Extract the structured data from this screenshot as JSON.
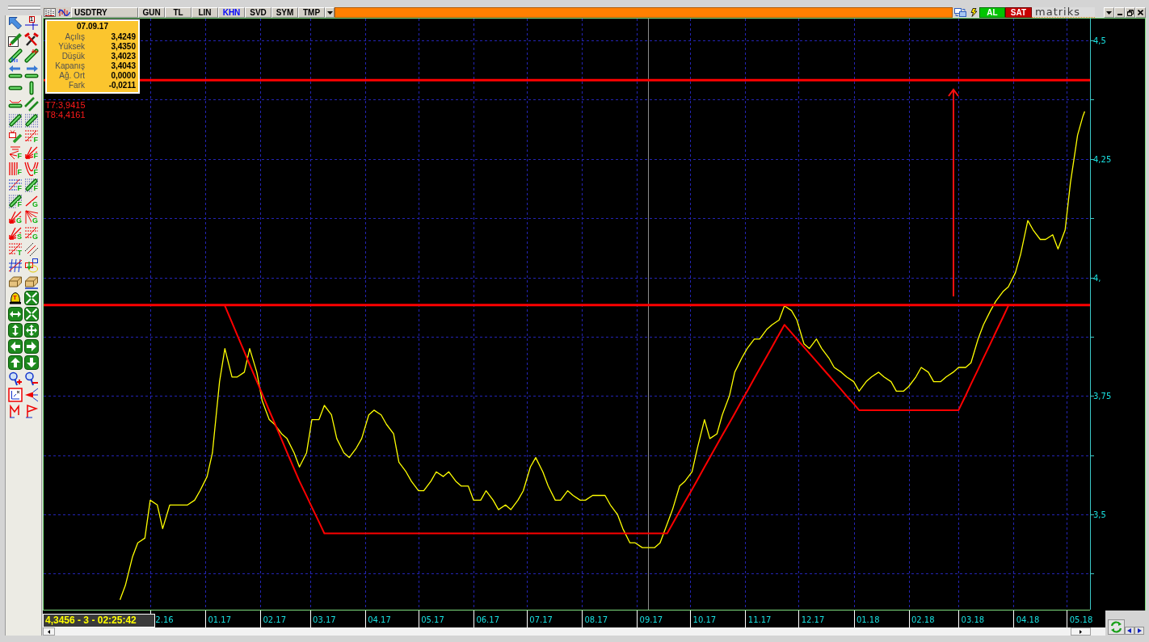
{
  "toolbar": {
    "symbol": "USDTRY",
    "buttons": [
      {
        "label": "GUN",
        "on": false
      },
      {
        "label": "TL",
        "on": false
      },
      {
        "label": "LIN",
        "on": false
      },
      {
        "label": "KHN",
        "on": true
      },
      {
        "label": "SVD",
        "on": false
      },
      {
        "label": "SYM",
        "on": false
      },
      {
        "label": "TMP",
        "on": false
      }
    ],
    "buy": "AL",
    "sell": "SAT",
    "logo": "matriks"
  },
  "drawing_tools": [
    {
      "kind": "pointer"
    },
    {
      "kind": "crosshair",
      "badge": "1"
    },
    {
      "kind": "pencil"
    },
    {
      "kind": "hammers"
    },
    {
      "kind": "trend"
    },
    {
      "kind": "trendmark"
    },
    {
      "kind": "extendleft"
    },
    {
      "kind": "extendright"
    },
    {
      "kind": "horizontal"
    },
    {
      "kind": "vertical"
    },
    {
      "kind": "ruler"
    },
    {
      "kind": "parallel"
    },
    {
      "kind": "dotted"
    },
    {
      "kind": "dotted"
    },
    {
      "kind": "note"
    },
    {
      "kind": "fibo",
      "badge": "F"
    },
    {
      "kind": "fibofan",
      "badge": "F"
    },
    {
      "kind": "fan",
      "badge": "F"
    },
    {
      "kind": "cycles",
      "badge": "F"
    },
    {
      "kind": "arcs",
      "badge": "F"
    },
    {
      "kind": "fibogrid",
      "badge": "F"
    },
    {
      "kind": "dotted",
      "badge": "F"
    },
    {
      "kind": "dotted",
      "badge": "F"
    },
    {
      "kind": "line",
      "badge": "G"
    },
    {
      "kind": "fan",
      "badge": "G"
    },
    {
      "kind": "fanlines",
      "badge": "G"
    },
    {
      "kind": "fan",
      "badge": "S"
    },
    {
      "kind": "fibo",
      "badge": "G"
    },
    {
      "kind": "fibo",
      "badge": "T"
    },
    {
      "kind": "channel"
    },
    {
      "kind": "hatch"
    },
    {
      "kind": "target"
    },
    {
      "kind": "eraser"
    },
    {
      "kind": "eraserline"
    },
    {
      "kind": "bell",
      "badge": "T"
    },
    {
      "kind": "shrink"
    },
    {
      "kind": "expandh"
    },
    {
      "kind": "shrink"
    },
    {
      "kind": "expandv"
    },
    {
      "kind": "expandall"
    },
    {
      "kind": "navleft"
    },
    {
      "kind": "navright"
    },
    {
      "kind": "navup"
    },
    {
      "kind": "navdown"
    },
    {
      "kind": "zoomin"
    },
    {
      "kind": "zoomout"
    },
    {
      "kind": "chartbox"
    },
    {
      "kind": "funnel"
    },
    {
      "kind": "flag"
    },
    {
      "kind": "flagalt"
    }
  ],
  "chart": {
    "info_box": {
      "date": "07.09.17",
      "rows": [
        {
          "label": "Açılış",
          "value": "3,4249"
        },
        {
          "label": "Yüksek",
          "value": "3,4350"
        },
        {
          "label": "Düşük",
          "value": "3,4023"
        },
        {
          "label": "Kapanış",
          "value": "3,4043"
        },
        {
          "label": "Ağ. Ort",
          "value": "0,0000"
        },
        {
          "label": "Fark",
          "value": "-0,0211"
        }
      ]
    },
    "chart_data": {
      "type": "line",
      "x": [
        "2016-11-14",
        "2016-11-17",
        "2016-11-21",
        "2016-11-24",
        "2016-11-28",
        "2016-12-01",
        "2016-12-05",
        "2016-12-08",
        "2016-12-12",
        "2016-12-15",
        "2016-12-19",
        "2016-12-22",
        "2016-12-26",
        "2016-12-29",
        "2017-01-02",
        "2017-01-05",
        "2017-01-09",
        "2017-01-12",
        "2017-01-16",
        "2017-01-19",
        "2017-01-23",
        "2017-01-26",
        "2017-01-30",
        "2017-02-02",
        "2017-02-06",
        "2017-02-09",
        "2017-02-13",
        "2017-02-16",
        "2017-02-20",
        "2017-02-23",
        "2017-02-27",
        "2017-03-02",
        "2017-03-06",
        "2017-03-09",
        "2017-03-13",
        "2017-03-16",
        "2017-03-20",
        "2017-03-23",
        "2017-03-27",
        "2017-03-30",
        "2017-04-03",
        "2017-04-06",
        "2017-04-10",
        "2017-04-13",
        "2017-04-17",
        "2017-04-20",
        "2017-04-24",
        "2017-04-27",
        "2017-05-01",
        "2017-05-04",
        "2017-05-08",
        "2017-05-11",
        "2017-05-15",
        "2017-05-18",
        "2017-05-22",
        "2017-05-25",
        "2017-05-29",
        "2017-06-01",
        "2017-06-05",
        "2017-06-08",
        "2017-06-12",
        "2017-06-15",
        "2017-06-19",
        "2017-06-22",
        "2017-06-26",
        "2017-06-29",
        "2017-07-03",
        "2017-07-06",
        "2017-07-10",
        "2017-07-13",
        "2017-07-17",
        "2017-07-20",
        "2017-07-24",
        "2017-07-27",
        "2017-07-31",
        "2017-08-03",
        "2017-08-07",
        "2017-08-10",
        "2017-08-14",
        "2017-08-17",
        "2017-08-21",
        "2017-08-24",
        "2017-08-28",
        "2017-08-31",
        "2017-09-04",
        "2017-09-07",
        "2017-09-11",
        "2017-09-14",
        "2017-09-18",
        "2017-09-21",
        "2017-09-25",
        "2017-09-28",
        "2017-10-02",
        "2017-10-05",
        "2017-10-09",
        "2017-10-12",
        "2017-10-16",
        "2017-10-19",
        "2017-10-23",
        "2017-10-26",
        "2017-10-30",
        "2017-11-02",
        "2017-11-06",
        "2017-11-09",
        "2017-11-13",
        "2017-11-16",
        "2017-11-20",
        "2017-11-23",
        "2017-11-27",
        "2017-11-30",
        "2017-12-04",
        "2017-12-07",
        "2017-12-11",
        "2017-12-14",
        "2017-12-18",
        "2017-12-21",
        "2017-12-25",
        "2017-12-28",
        "2018-01-01",
        "2018-01-04",
        "2018-01-08",
        "2018-01-11",
        "2018-01-15",
        "2018-01-18",
        "2018-01-22",
        "2018-01-25",
        "2018-01-29",
        "2018-02-01",
        "2018-02-05",
        "2018-02-08",
        "2018-02-12",
        "2018-02-15",
        "2018-02-19",
        "2018-02-22",
        "2018-02-26",
        "2018-03-01",
        "2018-03-05",
        "2018-03-08",
        "2018-03-12",
        "2018-03-15",
        "2018-03-19",
        "2018-03-22",
        "2018-03-26",
        "2018-03-29",
        "2018-04-02",
        "2018-04-05",
        "2018-04-09",
        "2018-04-12",
        "2018-04-16",
        "2018-04-19",
        "2018-04-23",
        "2018-04-26",
        "2018-04-30",
        "2018-05-03",
        "2018-05-07",
        "2018-05-10",
        "2018-05-11"
      ],
      "series": [
        {
          "color": "#ffff00",
          "values": [
            3.32,
            3.35,
            3.41,
            3.44,
            3.45,
            3.53,
            3.52,
            3.47,
            3.52,
            3.52,
            3.52,
            3.52,
            3.53,
            3.55,
            3.58,
            3.63,
            3.78,
            3.85,
            3.79,
            3.79,
            3.8,
            3.85,
            3.8,
            3.74,
            3.7,
            3.69,
            3.67,
            3.66,
            3.63,
            3.6,
            3.63,
            3.7,
            3.7,
            3.73,
            3.71,
            3.66,
            3.63,
            3.62,
            3.64,
            3.66,
            3.71,
            3.72,
            3.71,
            3.69,
            3.67,
            3.61,
            3.59,
            3.57,
            3.55,
            3.55,
            3.57,
            3.59,
            3.58,
            3.59,
            3.57,
            3.56,
            3.56,
            3.53,
            3.53,
            3.55,
            3.53,
            3.51,
            3.52,
            3.51,
            3.53,
            3.55,
            3.6,
            3.62,
            3.59,
            3.56,
            3.53,
            3.53,
            3.55,
            3.54,
            3.53,
            3.53,
            3.54,
            3.54,
            3.54,
            3.52,
            3.5,
            3.47,
            3.44,
            3.44,
            3.43,
            3.43,
            3.43,
            3.44,
            3.48,
            3.51,
            3.56,
            3.57,
            3.59,
            3.64,
            3.7,
            3.66,
            3.67,
            3.71,
            3.75,
            3.8,
            3.83,
            3.85,
            3.87,
            3.87,
            3.89,
            3.9,
            3.91,
            3.94,
            3.93,
            3.91,
            3.86,
            3.85,
            3.87,
            3.85,
            3.83,
            3.81,
            3.8,
            3.79,
            3.78,
            3.76,
            3.78,
            3.79,
            3.8,
            3.79,
            3.78,
            3.76,
            3.76,
            3.77,
            3.79,
            3.81,
            3.8,
            3.78,
            3.78,
            3.79,
            3.8,
            3.81,
            3.81,
            3.82,
            3.87,
            3.9,
            3.93,
            3.95,
            3.97,
            3.98,
            4.01,
            4.05,
            4.12,
            4.1,
            4.08,
            4.08,
            4.09,
            4.06,
            4.1,
            4.2,
            4.3,
            4.34,
            4.35
          ]
        },
        {
          "color": "#ff0000",
          "values": [
            null,
            null,
            null,
            null,
            null,
            null,
            null,
            null,
            null,
            null,
            null,
            null,
            null,
            null,
            null,
            null,
            null,
            3.94,
            3.905,
            3.878,
            3.843,
            3.816,
            3.781,
            3.755,
            3.719,
            3.693,
            3.658,
            3.631,
            3.596,
            3.57,
            3.539,
            3.515,
            3.484,
            3.46,
            3.46,
            3.46,
            3.46,
            3.46,
            3.46,
            3.46,
            3.46,
            3.46,
            3.46,
            3.46,
            3.46,
            3.46,
            3.46,
            3.46,
            3.46,
            3.46,
            3.46,
            3.46,
            3.46,
            3.46,
            3.46,
            3.46,
            3.46,
            3.46,
            3.46,
            3.46,
            3.46,
            3.46,
            3.46,
            3.46,
            3.46,
            3.46,
            3.46,
            3.46,
            3.46,
            3.46,
            3.46,
            3.46,
            3.46,
            3.46,
            3.46,
            3.46,
            3.46,
            3.46,
            3.46,
            3.46,
            3.46,
            3.46,
            3.46,
            3.46,
            3.46,
            3.46,
            3.46,
            3.46,
            3.46,
            3.48,
            3.507,
            3.527,
            3.553,
            3.573,
            3.6,
            3.62,
            3.647,
            3.667,
            3.693,
            3.713,
            3.74,
            3.76,
            3.787,
            3.807,
            3.833,
            3.853,
            3.88,
            3.9,
            3.883,
            3.87,
            3.853,
            3.84,
            3.823,
            3.81,
            3.793,
            3.78,
            3.763,
            3.75,
            3.733,
            3.72,
            3.72,
            3.72,
            3.72,
            3.72,
            3.72,
            3.72,
            3.72,
            3.72,
            3.72,
            3.72,
            3.72,
            3.72,
            3.72,
            3.72,
            3.72,
            3.72,
            3.751,
            3.775,
            3.806,
            3.83,
            3.861,
            3.885,
            3.916,
            3.94,
            null,
            null,
            null,
            null,
            null,
            null,
            null,
            null,
            null,
            null,
            null,
            null,
            null
          ]
        }
      ],
      "xlim": [
        "2016-10-02",
        "2018-05-14"
      ],
      "ylim": [
        3.299,
        4.546
      ],
      "xticks": [
        {
          "value": "2016-12-09",
          "label": "2.16"
        },
        {
          "value": "2017-01-09",
          "label": "01.17"
        },
        {
          "value": "2017-02-09",
          "label": "02.17"
        },
        {
          "value": "2017-03-09",
          "label": "03.17"
        },
        {
          "value": "2017-04-09",
          "label": "04.17"
        },
        {
          "value": "2017-05-09",
          "label": "05.17"
        },
        {
          "value": "2017-06-09",
          "label": "06.17"
        },
        {
          "value": "2017-07-09",
          "label": "07.17"
        },
        {
          "value": "2017-08-09",
          "label": "08.17"
        },
        {
          "value": "2017-09-09",
          "label": "09.17"
        },
        {
          "value": "2017-10-09",
          "label": "10.17"
        },
        {
          "value": "2017-11-09",
          "label": "11.17"
        },
        {
          "value": "2017-12-09",
          "label": "12.17"
        },
        {
          "value": "2018-01-09",
          "label": "01.18"
        },
        {
          "value": "2018-02-09",
          "label": "02.18"
        },
        {
          "value": "2018-03-09",
          "label": "03.18"
        },
        {
          "value": "2018-04-09",
          "label": "04.18"
        },
        {
          "value": "2018-05-09",
          "label": "05.18"
        }
      ],
      "yticks": [
        {
          "value": 3.5,
          "label": "3,5"
        },
        {
          "value": 3.75,
          "label": "3,75"
        },
        {
          "value": 4.0,
          "label": "4,"
        },
        {
          "value": 4.25,
          "label": "4,25"
        },
        {
          "value": 4.5,
          "label": "4,5"
        }
      ],
      "grid": true,
      "ref_lines": [
        {
          "axis": "x",
          "value": "2017-09-07",
          "color": "#8c8c8c"
        },
        {
          "axis": "y",
          "value": 3.9415,
          "color": "#ff0000"
        },
        {
          "axis": "y",
          "value": 4.4161,
          "color": "#ff0000"
        }
      ],
      "annotations": [
        "T7:3,9415",
        "T8:4,4161"
      ]
    }
  },
  "status": "4,3456 - 3 - 02:25:42"
}
